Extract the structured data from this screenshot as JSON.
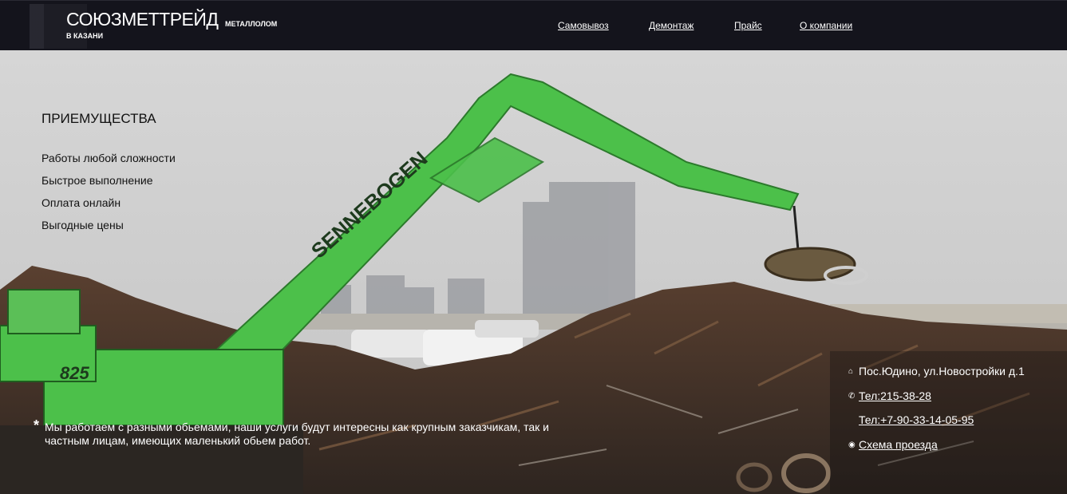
{
  "header": {
    "logo_title": "СОЮЗМЕТТРЕЙД",
    "logo_tag": "МЕТАЛЛОЛОМ",
    "logo_sub": "В КАЗАНИ",
    "nav": [
      {
        "label": "Самовывоз"
      },
      {
        "label": "Демонтаж"
      },
      {
        "label": "Прайс"
      },
      {
        "label": "О компании"
      }
    ]
  },
  "advantages": {
    "title": "ПРИЕМУЩЕСТВА",
    "items": [
      "Работы любой сложности",
      "Быстрое выполнение",
      "Оплата онлайн",
      "Выгодные цены"
    ]
  },
  "note": {
    "star": "*",
    "text": "Мы работаем с разными обьемами, наши услуги будут интересны как крупным заказчикам, так и частным лицам, имеющих маленький обьем работ."
  },
  "contacts": {
    "address": "Пос.Юдино, ул.Новостройки д.1",
    "phone1": "Тел:215-38-28",
    "phone2": "Тел:+7-90-33-14-05-95",
    "map_link": "Схема проезда",
    "icons": [
      "home-icon",
      "phone-icon",
      "phone-icon",
      "map-pin-icon"
    ]
  },
  "colors": {
    "header_bg": "#14141c",
    "excavator_green": "#4cc04a",
    "sky": "#cfcfcf"
  }
}
